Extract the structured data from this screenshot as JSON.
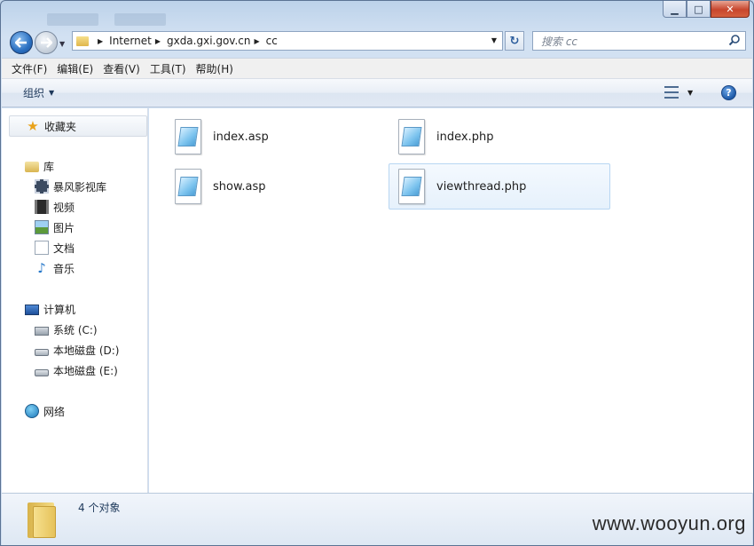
{
  "titlebar": {
    "minimize_glyph": "▁",
    "maximize_glyph": "□",
    "close_glyph": "✕"
  },
  "address_bar": {
    "crumbs": [
      "Internet",
      "gxda.gxi.gov.cn",
      "cc"
    ]
  },
  "search": {
    "placeholder": "搜索 cc"
  },
  "menu": {
    "items": [
      "文件(F)",
      "编辑(E)",
      "查看(V)",
      "工具(T)",
      "帮助(H)"
    ]
  },
  "toolbar": {
    "organize_label": "组织"
  },
  "sidebar": {
    "favorites_label": "收藏夹",
    "libraries_label": "库",
    "libraries": [
      "暴风影视库",
      "视频",
      "图片",
      "文档",
      "音乐"
    ],
    "computer_label": "计算机",
    "drives": [
      "系统 (C:)",
      "本地磁盘 (D:)",
      "本地磁盘 (E:)"
    ],
    "network_label": "网络"
  },
  "files": [
    {
      "name": "index.asp",
      "selected": false
    },
    {
      "name": "index.php",
      "selected": false
    },
    {
      "name": "show.asp",
      "selected": false
    },
    {
      "name": "viewthread.php",
      "selected": true
    }
  ],
  "status": {
    "item_count_text": "4 个对象"
  },
  "watermark": "www.wooyun.org"
}
